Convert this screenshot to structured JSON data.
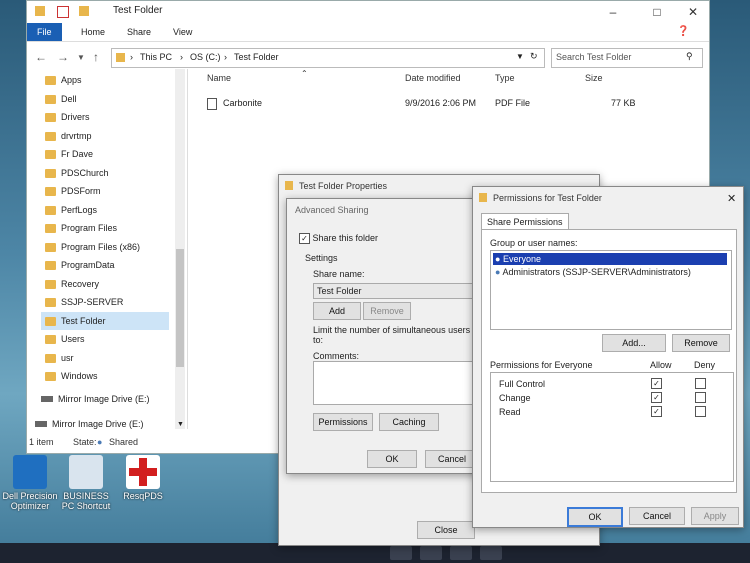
{
  "explorer": {
    "title": "Test Folder",
    "ribbon_tabs": [
      "File",
      "Home",
      "Share",
      "View"
    ],
    "breadcrumb": [
      "This PC",
      "OS (C:)",
      "Test Folder"
    ],
    "search_placeholder": "Search Test Folder",
    "nav_items": [
      "Apps",
      "Dell",
      "Drivers",
      "drvrtmp",
      "Fr Dave",
      "PDSChurch",
      "PDSForm",
      "PerfLogs",
      "Program Files",
      "Program Files (x86)",
      "ProgramData",
      "Recovery",
      "SSJP-SERVER",
      "Test Folder",
      "Users",
      "usr",
      "Windows"
    ],
    "nav_drives": [
      "Mirror Image Drive (E:)",
      "Mirror Image Drive (E:)"
    ],
    "columns": [
      "Name",
      "Date modified",
      "Type",
      "Size"
    ],
    "files": [
      {
        "name": "Carbonite",
        "date": "9/9/2016 2:06 PM",
        "type": "PDF File",
        "size": "77 KB"
      }
    ],
    "status": {
      "count": "1 item",
      "state_label": "State:",
      "state_value": "Shared"
    }
  },
  "desktop_icons": [
    {
      "label": "Dell Precision Optimizer"
    },
    {
      "label": "BUSINESS PC Shortcut"
    },
    {
      "label": "ResqPDS"
    }
  ],
  "properties": {
    "title": "Test Folder Properties",
    "close_label": "Close"
  },
  "advanced": {
    "title": "Advanced Sharing",
    "share_checkbox": "Share this folder",
    "settings_label": "Settings",
    "share_name_label": "Share name:",
    "share_name_value": "Test Folder",
    "add_label": "Add",
    "remove_label": "Remove",
    "limit_label": "Limit the number of simultaneous users to:",
    "comments_label": "Comments:",
    "permissions_label": "Permissions",
    "caching_label": "Caching",
    "ok_label": "OK",
    "cancel_label": "Cancel"
  },
  "perms": {
    "title": "Permissions for Test Folder",
    "tab": "Share Permissions",
    "group_label": "Group or user names:",
    "users": [
      "Everyone",
      "Administrators (SSJP-SERVER\\Administrators)"
    ],
    "add_label": "Add...",
    "remove_label": "Remove",
    "perm_for_label": "Permissions for Everyone",
    "allow_label": "Allow",
    "deny_label": "Deny",
    "rows": [
      {
        "name": "Full Control",
        "allow": true,
        "deny": false
      },
      {
        "name": "Change",
        "allow": true,
        "deny": false
      },
      {
        "name": "Read",
        "allow": true,
        "deny": false
      }
    ],
    "ok_label": "OK",
    "cancel_label": "Cancel",
    "apply_label": "Apply"
  },
  "colors": {
    "accent": "#1a5fb4",
    "selection": "#1b3fb0",
    "folder": "#e8b64c"
  }
}
